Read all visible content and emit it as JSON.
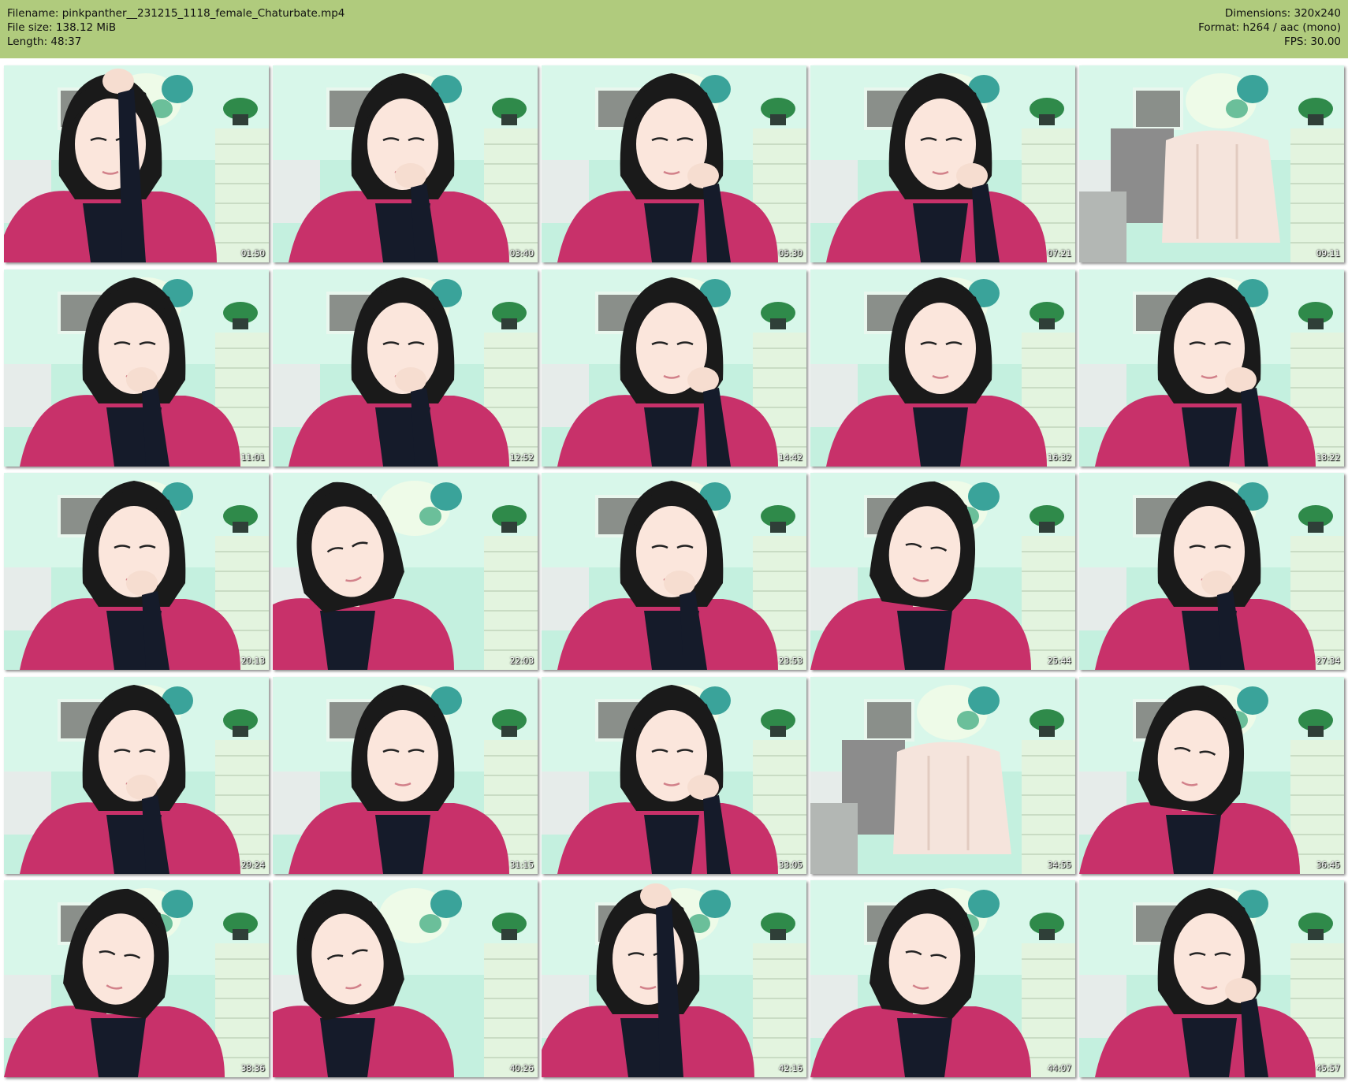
{
  "info": {
    "filename": "Filename: pinkpanther__231215_1118_female_Chaturbate.mp4",
    "filesize": "File size: 138.12 MiB",
    "length": "Length: 48:37",
    "dimensions": "Dimensions: 320x240",
    "format": "Format: h264 / aac (mono)",
    "fps": "FPS: 30.00"
  },
  "colors": {
    "header_bg": "#b0cb7d",
    "robe": "#c8316a",
    "hair": "#1a1a1a",
    "background_tint": "#b9ead6"
  },
  "thumbnails": [
    {
      "time": "01:50",
      "scene": "person-hand-on-head"
    },
    {
      "time": "03:40",
      "scene": "person-hand-on-chin"
    },
    {
      "time": "05:30",
      "scene": "person-head-on-hand"
    },
    {
      "time": "07:21",
      "scene": "person-head-on-hand"
    },
    {
      "time": "09:11",
      "scene": "empty-chair-with-jacket"
    },
    {
      "time": "11:01",
      "scene": "person-hand-on-chin"
    },
    {
      "time": "12:52",
      "scene": "person-hand-on-chin"
    },
    {
      "time": "14:42",
      "scene": "person-head-on-hand"
    },
    {
      "time": "16:32",
      "scene": "person-talking"
    },
    {
      "time": "18:22",
      "scene": "person-head-on-hand"
    },
    {
      "time": "20:13",
      "scene": "person-hand-on-chin"
    },
    {
      "time": "22:03",
      "scene": "person-leaning-left"
    },
    {
      "time": "23:53",
      "scene": "person-hand-on-chin"
    },
    {
      "time": "25:44",
      "scene": "person-looking-down"
    },
    {
      "time": "27:34",
      "scene": "person-hand-on-chin"
    },
    {
      "time": "29:24",
      "scene": "person-hand-on-mouth"
    },
    {
      "time": "31:15",
      "scene": "person-talking"
    },
    {
      "time": "33:05",
      "scene": "person-head-on-hand"
    },
    {
      "time": "34:55",
      "scene": "empty-chair-with-jacket"
    },
    {
      "time": "36:45",
      "scene": "person-looking-down"
    },
    {
      "time": "38:36",
      "scene": "person-looking-down"
    },
    {
      "time": "40:26",
      "scene": "person-leaning-left"
    },
    {
      "time": "42:16",
      "scene": "person-hand-on-head"
    },
    {
      "time": "44:07",
      "scene": "person-looking-down"
    },
    {
      "time": "45:57",
      "scene": "person-hand-on-face"
    }
  ]
}
